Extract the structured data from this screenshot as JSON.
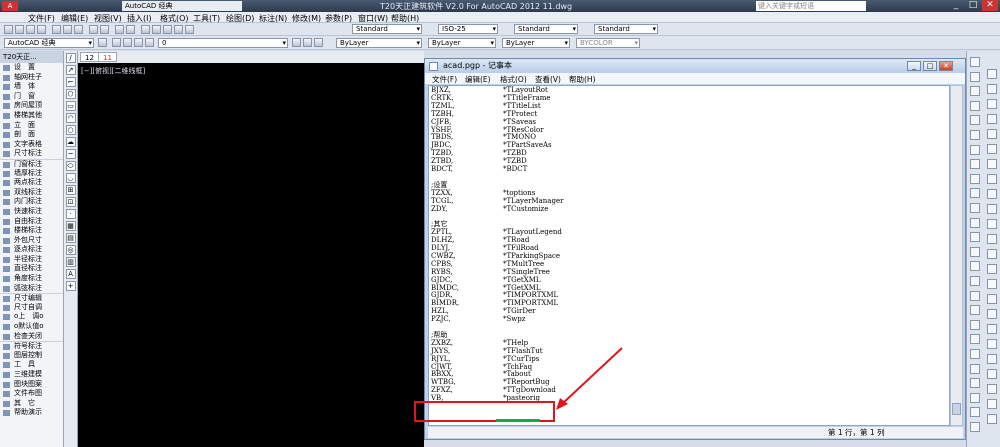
{
  "app": {
    "title": "T20天正建筑软件 V2.0 For AutoCAD 2012     11.dwg",
    "workspace": "AutoCAD 经典",
    "search_placeholder": "键入关键字或短语",
    "menus": [
      "文件(F)",
      "编辑(E)",
      "视图(V)",
      "插入(I)",
      "格式(O)",
      "工具(T)",
      "绘图(D)",
      "标注(N)",
      "修改(M)",
      "参数(P)",
      "窗口(W)",
      "帮助(H)"
    ]
  },
  "toolbar": {
    "text_style": "Standard",
    "dim_style": "ISO-25",
    "table_style": "Standard",
    "ml_style": "Standard",
    "workspace2": "AutoCAD 经典",
    "layer": "0",
    "color": "ByLayer",
    "linetype": "ByLayer",
    "lineweight": "ByLayer",
    "plotstyle": "BYCOLOR"
  },
  "left_panel": {
    "header": "T20天正...",
    "items": [
      "设　置",
      "轴网柱子",
      "墙　体",
      "门　窗",
      "房间屋顶",
      "楼梯其他",
      "立　面",
      "剖　面",
      "文字表格",
      "尺寸标注",
      "门窗标注",
      "墙厚标注",
      "两点标注",
      "双线标注",
      "内门标注",
      "快速标注",
      "自由标注",
      "楼梯标注",
      "外包尺寸",
      "逐点标注",
      "半径标注",
      "直径标注",
      "角度标注",
      "弧弦标注",
      "尺寸编辑",
      "尺寸自调",
      "o上　调o",
      "o默认值o",
      "检查关闭",
      "符号标注",
      "图层控制",
      "工　具",
      "三维建模",
      "图块图案",
      "文件布图",
      "其　它",
      "帮助演示"
    ]
  },
  "doc_tabs": [
    "12",
    "11"
  ],
  "viewport_label": "[−][俯视][二维线框]",
  "notepad": {
    "title": "acad.pgp - 记事本",
    "menus": [
      "文件(F)",
      "编辑(E)",
      "格式(O)",
      "查看(V)",
      "帮助(H)"
    ],
    "lines": [
      [
        "BJXZ,",
        "*TLayoutRot"
      ],
      [
        "CRTK,",
        "*TTitleFrame"
      ],
      [
        "TZML,",
        "*TTitleList"
      ],
      [
        "TZBH,",
        "*TProtect"
      ],
      [
        "CJFB,",
        "*TSaveas"
      ],
      [
        "YSHF,",
        "*TResColor"
      ],
      [
        "TBDS,",
        "*TMONO"
      ],
      [
        "JBDC,",
        "*TPartSaveAs"
      ],
      [
        "TZBD,",
        "*TZBD"
      ],
      [
        "ZTBD,",
        "*TZBD"
      ],
      [
        "BDCT,",
        "*BDCT"
      ],
      [
        "",
        ""
      ],
      [
        ";设置",
        ""
      ],
      [
        "TZXX,",
        "*toptions"
      ],
      [
        "TCGL,",
        "*TLayerManager"
      ],
      [
        "ZDY,",
        "*TCustomize"
      ],
      [
        "",
        ""
      ],
      [
        ";其它",
        ""
      ],
      [
        "ZPTL,",
        "*TLayoutLegend"
      ],
      [
        "DLHZ,",
        "*TRoad"
      ],
      [
        "DLYJ,",
        "*TFilRoad"
      ],
      [
        "CWBZ,",
        "*TParkingSpace"
      ],
      [
        "CPBS,",
        "*TMultTree"
      ],
      [
        "RYBS,",
        "*TSingleTree"
      ],
      [
        "GJDC,",
        "*TGetXML"
      ],
      [
        "BIMDC,",
        "*TGetXML"
      ],
      [
        "GJDR,",
        "*TIMPORTXML"
      ],
      [
        "BIMDR,",
        "*TIMPORTXML"
      ],
      [
        "HZL,",
        "*TGirDer"
      ],
      [
        "PZJC,",
        "*Swpz"
      ],
      [
        "",
        ""
      ],
      [
        ";帮助",
        ""
      ],
      [
        "ZXBZ,",
        "*THelp"
      ],
      [
        "JXYS,",
        "*TFlashTut"
      ],
      [
        "RJYL,",
        "*TCurTips"
      ],
      [
        "CJWT,",
        "*TchFaq"
      ],
      [
        "BBXX,",
        "*Tabout"
      ],
      [
        "WTBG,",
        "*TReportBug"
      ],
      [
        "ZFXZ,",
        "*TTgDownload"
      ],
      [
        "VB,",
        "*pasteorig"
      ]
    ],
    "status": "第 1 行，第 1 列"
  }
}
